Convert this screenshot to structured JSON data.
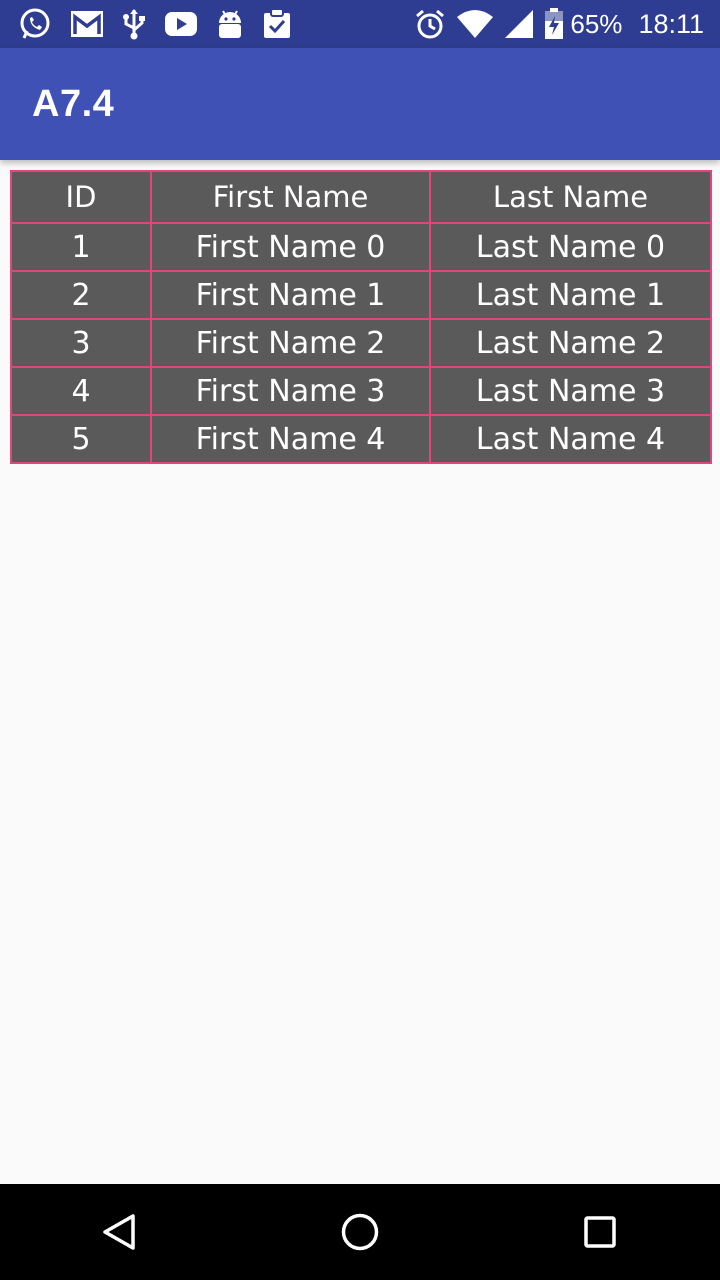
{
  "status_bar": {
    "left_icons": [
      "whatsapp-icon",
      "gmail-icon",
      "usb-icon",
      "youtube-icon",
      "android-icon",
      "clipboard-check-icon"
    ],
    "right_icons": [
      "alarm-icon",
      "wifi-icon",
      "signal-icon",
      "battery-charging-icon"
    ],
    "battery": "65%",
    "time": "18:11"
  },
  "app_bar": {
    "title": "A7.4",
    "color": "#3f51b5"
  },
  "table": {
    "columns": [
      "ID",
      "First Name",
      "Last Name"
    ],
    "rows": [
      [
        "1",
        "First Name 0",
        "Last Name 0"
      ],
      [
        "2",
        "First Name 1",
        "Last Name 1"
      ],
      [
        "3",
        "First Name 2",
        "Last Name 2"
      ],
      [
        "4",
        "First Name 3",
        "Last Name 3"
      ],
      [
        "5",
        "First Name 4",
        "Last Name 4"
      ]
    ],
    "cell_background": "#5a5a5a",
    "border_color": "#e0457b"
  },
  "nav_bar": {
    "buttons": [
      "back-icon",
      "home-icon",
      "recents-icon"
    ]
  }
}
